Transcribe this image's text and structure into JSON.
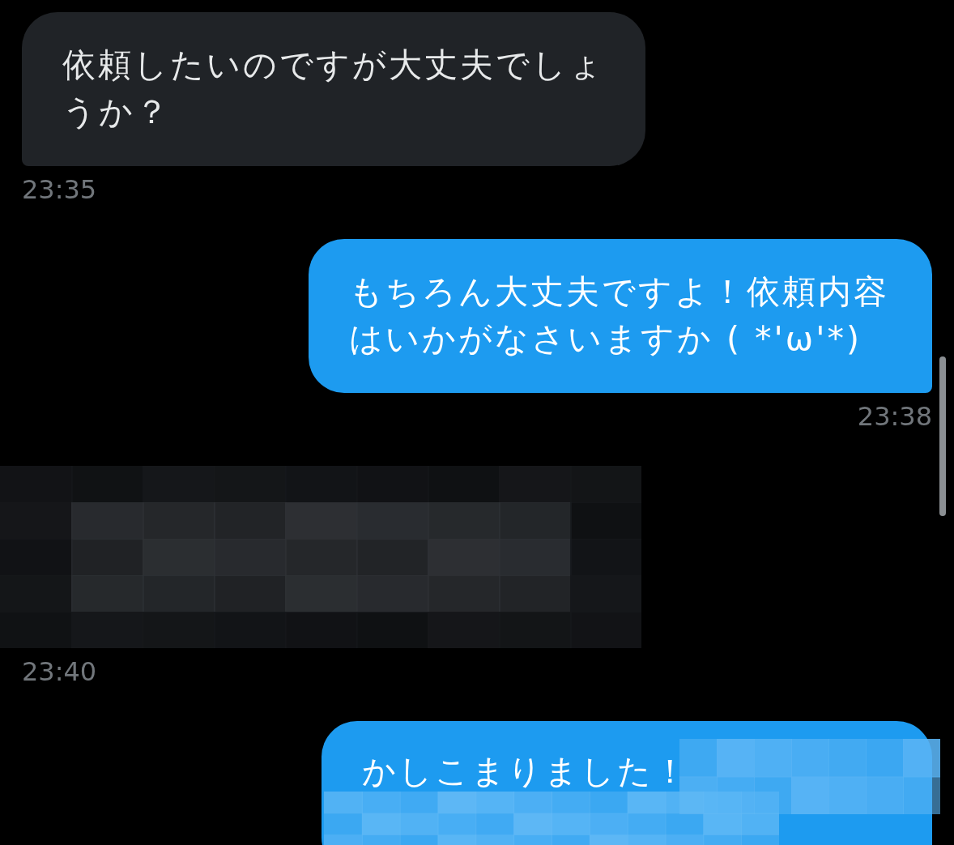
{
  "messages": [
    {
      "kind": "text",
      "outgoing": false,
      "text": "依頼したいのですが大丈夫でしょうか？",
      "time": "23:35"
    },
    {
      "kind": "text",
      "outgoing": true,
      "text": "もちろん大丈夫ですよ！依頼内容はいかがなさいますか ( *'ω'*)",
      "time": "23:38"
    },
    {
      "kind": "redacted",
      "outgoing": false,
      "time": "23:40"
    },
    {
      "kind": "partly_redacted",
      "outgoing": true,
      "text": "かしこまりました！"
    }
  ]
}
